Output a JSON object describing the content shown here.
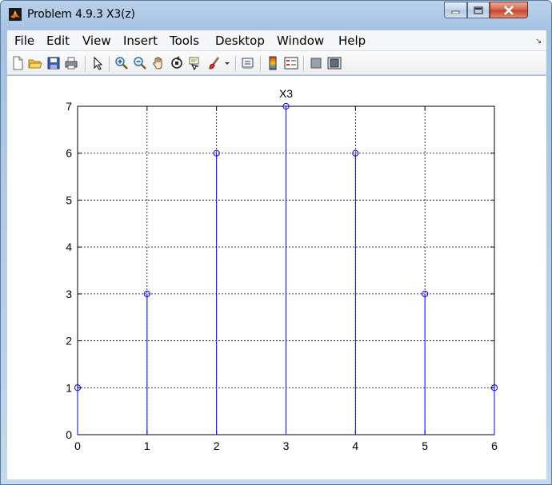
{
  "window": {
    "title": "Problem 4.9.3 X3(z)"
  },
  "menu": {
    "items": [
      "File",
      "Edit",
      "View",
      "Insert",
      "Tools",
      "Desktop",
      "Window",
      "Help"
    ]
  },
  "toolbar": {
    "buttons": [
      "new-figure-icon",
      "open-file-icon",
      "save-icon",
      "print-icon",
      "edit-plot-arrow-icon",
      "zoom-in-icon",
      "zoom-out-icon",
      "pan-hand-icon",
      "rotate-3d-icon",
      "data-cursor-icon",
      "brush-icon",
      "brush-dropdown-icon",
      "link-plot-icon",
      "insert-colorbar-icon",
      "insert-legend-icon",
      "hide-plot-tools-icon",
      "show-plot-tools-icon"
    ]
  },
  "colors": {
    "stem": "#0000ff",
    "grid": "#000000",
    "accent_window": "#b9d1ea"
  },
  "chart_data": {
    "type": "stem",
    "title": "X3",
    "xlabel": "",
    "ylabel": "",
    "x": [
      0,
      1,
      2,
      3,
      4,
      5,
      6
    ],
    "y": [
      1,
      3,
      6,
      7,
      6,
      3,
      1
    ],
    "xlim": [
      0,
      6
    ],
    "ylim": [
      0,
      7
    ],
    "xticks": [
      "0",
      "1",
      "2",
      "3",
      "4",
      "5",
      "6"
    ],
    "yticks": [
      "0",
      "1",
      "2",
      "3",
      "4",
      "5",
      "6",
      "7"
    ],
    "grid": true,
    "marker": "circle"
  }
}
